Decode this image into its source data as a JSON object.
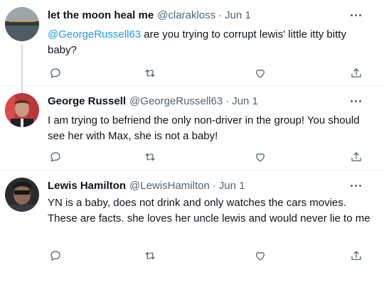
{
  "tweets": [
    {
      "name": "let the moon heal me",
      "handle": "@clarakloss",
      "sep": "·",
      "date": "Jun 1",
      "mention": "@GeorgeRussell63",
      "text": " are you trying to corrupt lewis' little itty bitty baby?"
    },
    {
      "name": "George Russell",
      "handle": "@GeorgeRussell63",
      "sep": "·",
      "date": "Jun 1",
      "mention": "",
      "text": "I am trying to befriend the only non-driver in the group! You should see her with Max, she is not a baby!"
    },
    {
      "name": "Lewis Hamilton",
      "handle": "@LewisHamilton",
      "sep": "·",
      "date": "Jun 1",
      "mention": "",
      "text": "YN is a baby, does not drink and only watches the cars movies. These are facts. she loves her uncle lewis and would never lie to me"
    }
  ],
  "icons": {
    "reply": "reply-icon",
    "retweet": "retweet-icon",
    "like": "like-icon",
    "share": "share-icon",
    "more": "more-icon"
  },
  "colors": {
    "accent": "#1d9bf0",
    "text": "#0f1419",
    "muted": "#536471"
  }
}
